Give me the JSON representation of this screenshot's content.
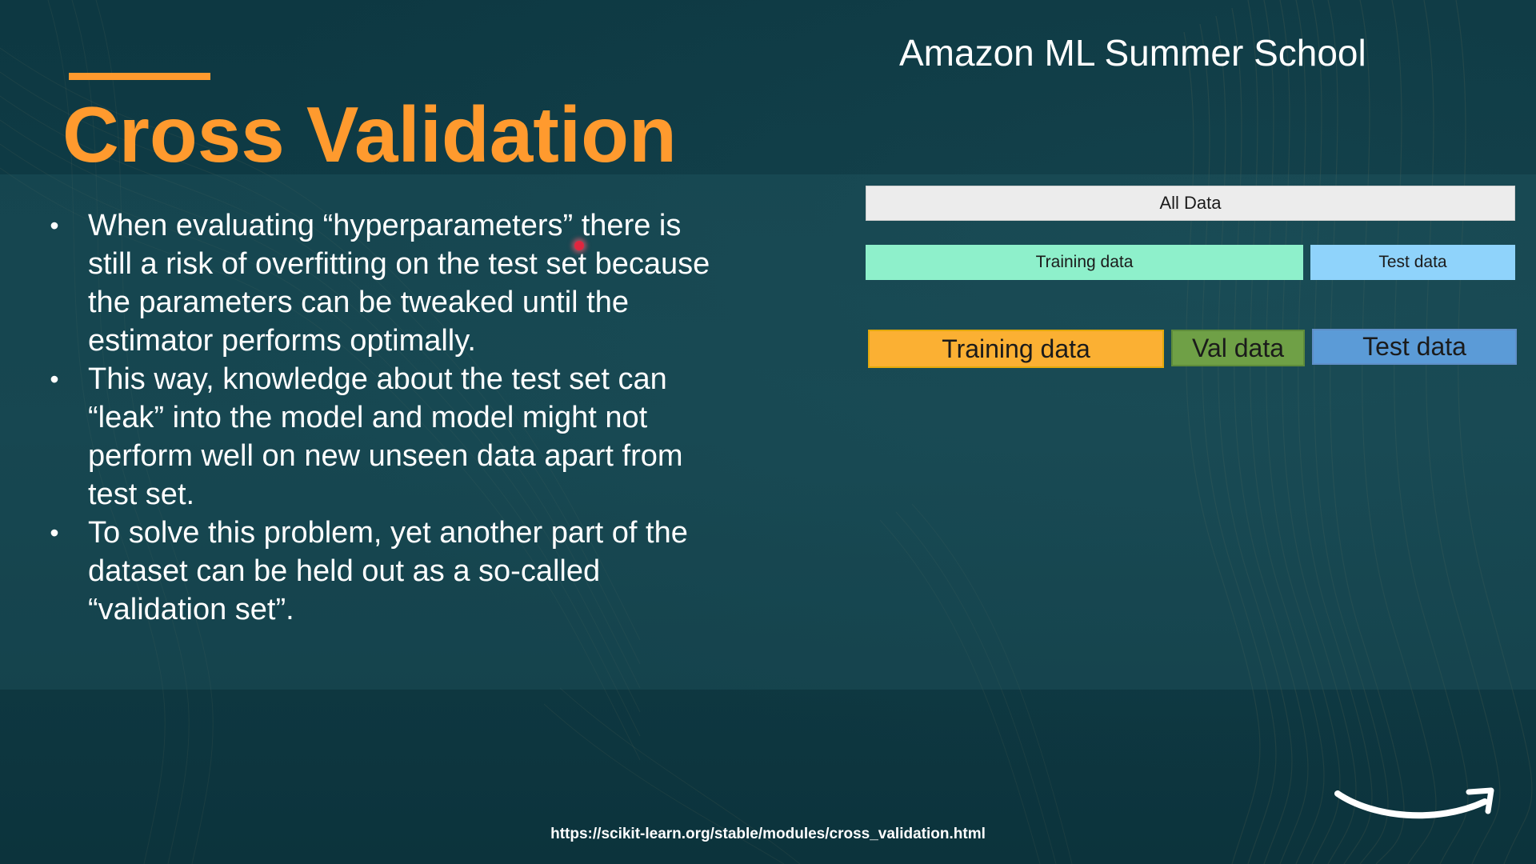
{
  "slide": {
    "header": "Amazon ML Summer School",
    "title": "Cross Validation",
    "bullets": [
      {
        "text": "When evaluating “hyperparameters” there is\nstill a risk of overfitting on the test set because\nthe parameters can be tweaked until the\nestimator performs optimally."
      },
      {
        "text": "This way, knowledge about the test set can\n“leak” into the model and model might not\nperform well on new unseen data apart from\ntest set."
      },
      {
        "text": "To solve this problem, yet another part of the\ndataset can be held out as a so-called\n“validation set”."
      }
    ],
    "bullet_symbol": "•",
    "diagram": {
      "row1": {
        "label": "All Data",
        "color": "#ececec"
      },
      "row2": [
        {
          "label": "Training data",
          "color": "#8ef0cb"
        },
        {
          "label": "Test data",
          "color": "#8fd3fb"
        }
      ],
      "row3": [
        {
          "label": "Training data",
          "color": "#fbb033"
        },
        {
          "label": "Val data",
          "color": "#6fa046"
        },
        {
          "label": "Test data",
          "color": "#5b9bd7"
        }
      ]
    },
    "footer_url": "https://scikit-learn.org/stable/modules/cross_validation.html",
    "logo_icon": "amazon-smile-icon",
    "colors": {
      "accent": "#ff9a2e",
      "title": "#ff9a2e",
      "background": "#0f3a44",
      "text": "#ffffff"
    }
  }
}
